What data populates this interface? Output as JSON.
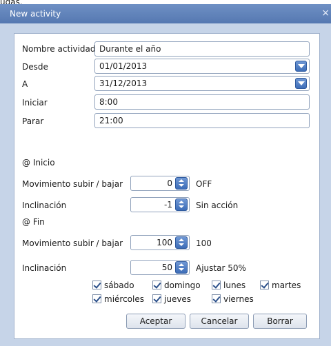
{
  "window": {
    "title": "New activity",
    "close_glyph": "×"
  },
  "fields": {
    "nombre_label": "Nombre actividad",
    "nombre_value": "Durante el año",
    "desde_label": "Desde",
    "desde_value": "01/01/2013",
    "a_label": "A",
    "a_value": "31/12/2013",
    "iniciar_label": "Iniciar",
    "iniciar_value": "8:00",
    "parar_label": "Parar",
    "parar_value": "21:00"
  },
  "inicio": {
    "heading": "@ Inicio",
    "mov_label": "Movimiento subir / bajar",
    "mov_value": "0",
    "mov_status": "OFF",
    "incl_label": "Inclinación",
    "incl_value": "-1",
    "incl_status": "Sin acción"
  },
  "fin": {
    "heading": "@ Fin",
    "mov_label": "Movimiento subir / bajar",
    "mov_value": "100",
    "mov_status": "100",
    "incl_label": "Inclinación",
    "incl_value": "50",
    "incl_status": "Ajustar 50%"
  },
  "days": [
    {
      "label": "sábado",
      "checked": true
    },
    {
      "label": "domingo",
      "checked": true
    },
    {
      "label": "lunes",
      "checked": true
    },
    {
      "label": "martes",
      "checked": true
    },
    {
      "label": "miércoles",
      "checked": true
    },
    {
      "label": "jueves",
      "checked": true
    },
    {
      "label": "viernes",
      "checked": true
    }
  ],
  "buttons": {
    "accept": "Aceptar",
    "cancel": "Cancelar",
    "delete": "Borrar"
  },
  "icons": {
    "dropdown": "chevron-down-icon",
    "spin": "spin-updown-icon",
    "check": "checkmark-icon"
  }
}
